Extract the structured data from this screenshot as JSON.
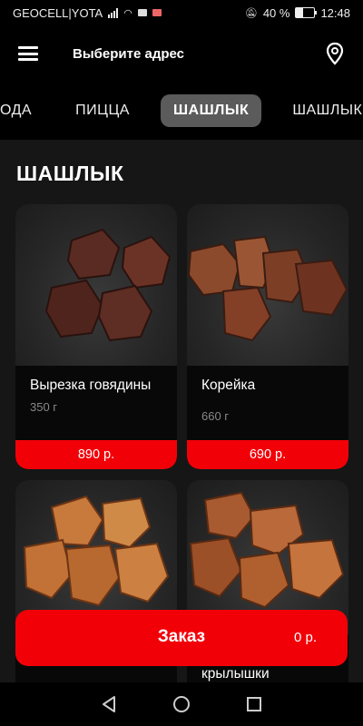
{
  "status_bar": {
    "carrier": "GEOCELL|YOTA",
    "battery_percent": "40 %",
    "battery_level": 0.4,
    "time": "12:48"
  },
  "header": {
    "address_prompt": "Выберите адрес",
    "menu_icon": "hamburger-menu-icon",
    "location_icon": "location-pin-icon"
  },
  "tabs": [
    {
      "label": "ОДА",
      "active": false
    },
    {
      "label": "ПИЦЦА",
      "active": false
    },
    {
      "label": "ШАШЛЫК",
      "active": true
    },
    {
      "label": "ШАШЛЫК ИЗ С",
      "active": false
    }
  ],
  "section": {
    "title": "ШАШЛЫК"
  },
  "products": [
    {
      "name": "Вырезка говядины",
      "weight": "350 г",
      "price": "890 р."
    },
    {
      "name": "Корейка",
      "weight": "660 г",
      "price": "690 р."
    },
    {
      "name": "",
      "weight": "",
      "price": ""
    },
    {
      "name": "крылышки",
      "weight": "",
      "price": ""
    }
  ],
  "order_button": {
    "label": "Заказ",
    "total": "0 р."
  },
  "colors": {
    "accent": "#f20008",
    "background": "#161616",
    "card": "#080808",
    "active_tab": "#5b5b5b"
  },
  "navigation_bar": {
    "back_icon": "back-triangle-icon",
    "home_icon": "home-circle-icon",
    "recents_icon": "recents-square-icon"
  }
}
